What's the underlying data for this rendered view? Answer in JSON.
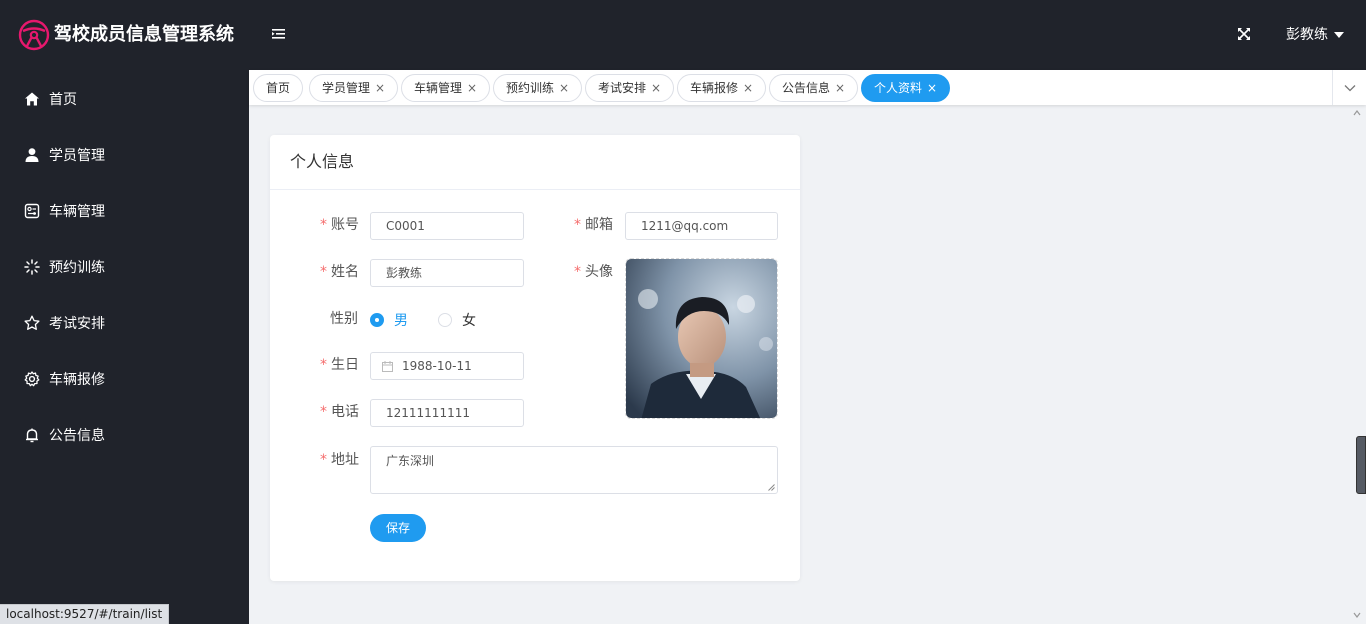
{
  "header": {
    "app_title": "驾校成员信息管理系统",
    "user_name": "彭教练",
    "logo_icon": "steering-wheel-icon",
    "accent_color": "#e6186d"
  },
  "sidebar": {
    "items": [
      {
        "label": "首页",
        "icon": "home-icon"
      },
      {
        "label": "学员管理",
        "icon": "user-icon"
      },
      {
        "label": "车辆管理",
        "icon": "vehicle-icon"
      },
      {
        "label": "预约训练",
        "icon": "loading-icon"
      },
      {
        "label": "考试安排",
        "icon": "star-icon"
      },
      {
        "label": "车辆报修",
        "icon": "gear-icon"
      },
      {
        "label": "公告信息",
        "icon": "bell-icon"
      }
    ]
  },
  "tags": {
    "items": [
      {
        "label": "首页",
        "closable": false
      },
      {
        "label": "学员管理",
        "closable": true
      },
      {
        "label": "车辆管理",
        "closable": true
      },
      {
        "label": "预约训练",
        "closable": true
      },
      {
        "label": "考试安排",
        "closable": true
      },
      {
        "label": "车辆报修",
        "closable": true
      },
      {
        "label": "公告信息",
        "closable": true
      },
      {
        "label": "个人资料",
        "closable": true,
        "active": true
      }
    ],
    "close_glyph": "×"
  },
  "card": {
    "title": "个人信息"
  },
  "form": {
    "account_label": "账号",
    "account_value": "C0001",
    "email_label": "邮箱",
    "email_value": "1211@qq.com",
    "name_label": "姓名",
    "name_value": "彭教练",
    "avatar_label": "头像",
    "gender_label": "性别",
    "gender_male": "男",
    "gender_female": "女",
    "gender_selected": "男",
    "birthday_label": "生日",
    "birthday_value": "1988-10-11",
    "phone_label": "电话",
    "phone_value": "12111111111",
    "address_label": "地址",
    "address_value": "广东深圳",
    "required_mark": "*",
    "save_label": "保存"
  },
  "statusbar": {
    "url": "localhost:9527/#/train/list"
  },
  "colors": {
    "primary": "#1f9bf0",
    "sidebar_bg": "#20232b",
    "required": "#f56c6c"
  }
}
